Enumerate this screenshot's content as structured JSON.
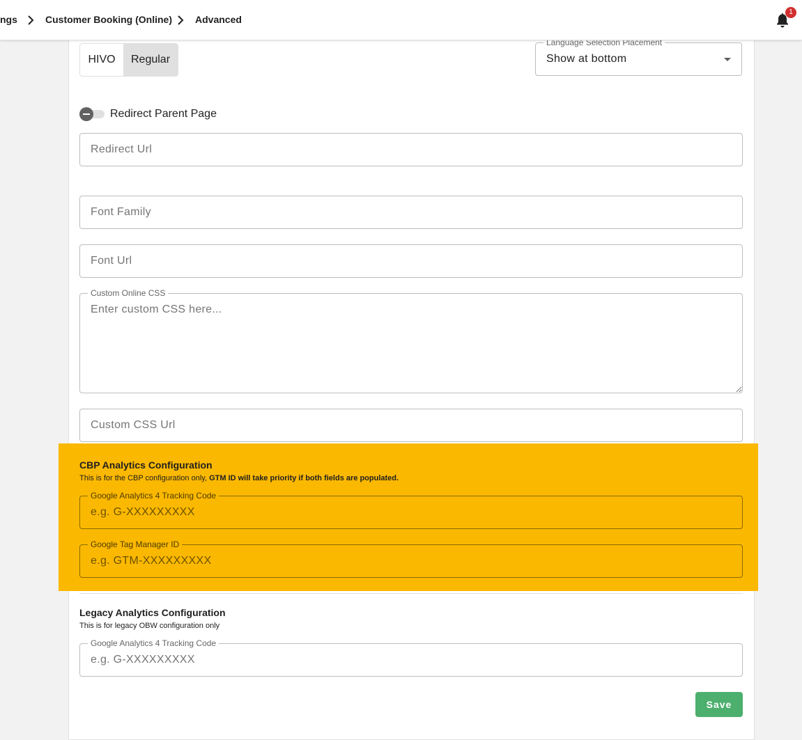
{
  "breadcrumb": {
    "items": [
      "ngs",
      "Customer Booking (Online)",
      "Advanced"
    ]
  },
  "notifications": {
    "count": "1",
    "icon": "bell-icon"
  },
  "mode_toggle": {
    "options": [
      "HIVO",
      "Regular"
    ],
    "selected": "Regular"
  },
  "language_placement": {
    "label": "Language Selection Placement",
    "value": "Show at bottom"
  },
  "redirect": {
    "toggle_label": "Redirect Parent Page",
    "toggle_on": false,
    "url_placeholder": "Redirect Url"
  },
  "font": {
    "family_placeholder": "Font Family",
    "url_placeholder": "Font Url"
  },
  "custom_css": {
    "label": "Custom Online CSS",
    "placeholder": "Enter custom CSS here...",
    "url_placeholder": "Custom CSS Url"
  },
  "cbp_analytics": {
    "title": "CBP Analytics Configuration",
    "desc_plain": "This is for the CBP configuration only, ",
    "desc_bold": "GTM ID will take priority if both fields are populated.",
    "ga4_label": "Google Analytics 4 Tracking Code",
    "ga4_placeholder": "e.g. G-XXXXXXXXX",
    "gtm_label": "Google Tag Manager ID",
    "gtm_placeholder": "e.g. GTM-XXXXXXXXX",
    "highlight_color": "#fbb800"
  },
  "legacy_analytics": {
    "title": "Legacy Analytics Configuration",
    "desc": "This is for legacy OBW configuration only",
    "ga4_label": "Google Analytics 4 Tracking Code",
    "ga4_placeholder": "e.g. G-XXXXXXXXX"
  },
  "actions": {
    "save_label": "Save",
    "save_color": "#4caf6e"
  }
}
